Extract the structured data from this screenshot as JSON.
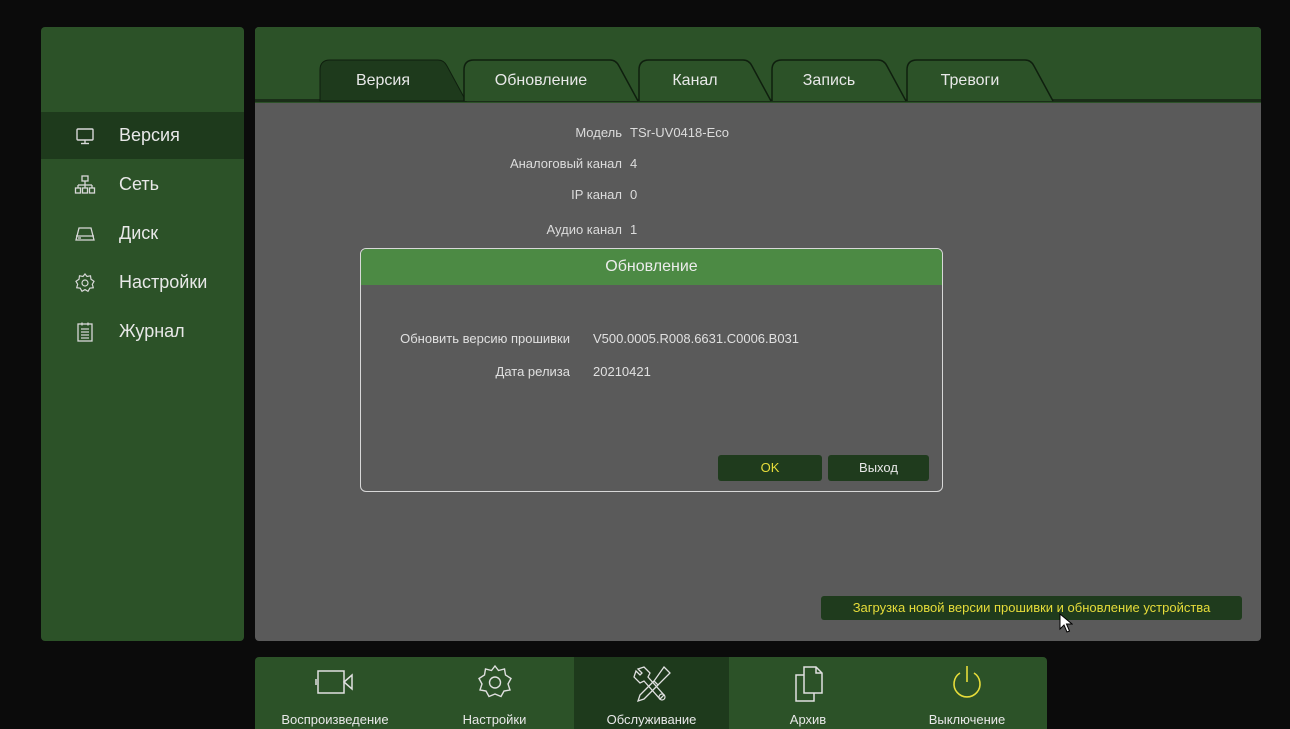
{
  "sidebar": {
    "items": [
      {
        "label": "Версия",
        "icon": "monitor-icon",
        "active": true
      },
      {
        "label": "Сеть",
        "icon": "network-icon",
        "active": false
      },
      {
        "label": "Диск",
        "icon": "disk-icon",
        "active": false
      },
      {
        "label": "Настройки",
        "icon": "gear-icon",
        "active": false
      },
      {
        "label": "Журнал",
        "icon": "log-icon",
        "active": false
      }
    ]
  },
  "tabs": [
    {
      "label": "Версия",
      "active": true
    },
    {
      "label": "Обновление",
      "active": false
    },
    {
      "label": "Канал",
      "active": false
    },
    {
      "label": "Запись",
      "active": false
    },
    {
      "label": "Тревоги",
      "active": false
    }
  ],
  "info": {
    "model_label": "Модель",
    "model_value": "TSr-UV0418-Eco",
    "analog_label": "Аналоговый канал",
    "analog_value": "4",
    "ip_label": "IP канал",
    "ip_value": "0",
    "audio_label": "Аудио канал",
    "audio_value": "1"
  },
  "dialog": {
    "title": "Обновление",
    "firmware_label": "Обновить версию прошивки",
    "firmware_value": "V500.0005.R008.6631.C0006.B031",
    "date_label": "Дата релиза",
    "date_value": "20210421",
    "ok_label": "OK",
    "exit_label": "Выход"
  },
  "hint": "Загрузка новой версии прошивки и обновление устройства",
  "dock": {
    "items": [
      {
        "label": "Воспроизведение",
        "icon": "camera-icon",
        "active": false
      },
      {
        "label": "Настройки",
        "icon": "gear-icon",
        "active": false
      },
      {
        "label": "Обслуживание",
        "icon": "tools-icon",
        "active": true
      },
      {
        "label": "Архив",
        "icon": "archive-icon",
        "active": false
      },
      {
        "label": "Выключение",
        "icon": "power-icon",
        "active": false
      }
    ]
  },
  "colors": {
    "panel_green": "#2c5228",
    "active_green": "#1e3a1c",
    "dialog_header": "#4c8a44",
    "content_gray": "#5a5a5a",
    "highlight_yellow": "#e6dc3a"
  }
}
